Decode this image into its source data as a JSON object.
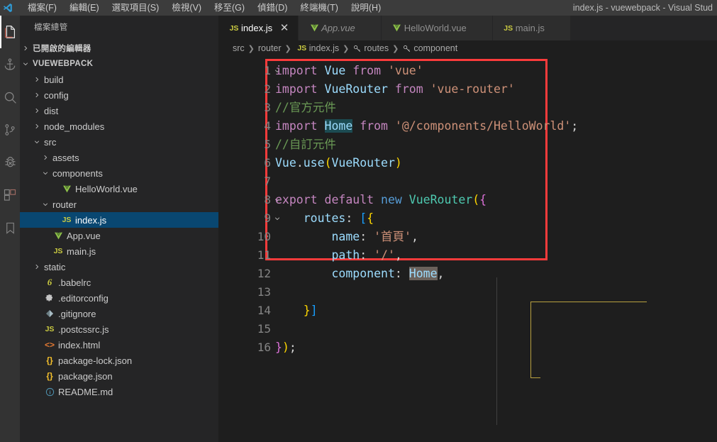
{
  "window": {
    "title": "index.js - vuewebpack - Visual Stud"
  },
  "menu": {
    "items": [
      {
        "label": "檔案(F)",
        "name": "menu-file"
      },
      {
        "label": "編輯(E)",
        "name": "menu-edit"
      },
      {
        "label": "選取項目(S)",
        "name": "menu-selection"
      },
      {
        "label": "檢視(V)",
        "name": "menu-view"
      },
      {
        "label": "移至(G)",
        "name": "menu-go"
      },
      {
        "label": "偵錯(D)",
        "name": "menu-debug"
      },
      {
        "label": "終端機(T)",
        "name": "menu-terminal"
      },
      {
        "label": "說明(H)",
        "name": "menu-help"
      }
    ]
  },
  "activitybar": {
    "items": [
      {
        "icon": "explorer-files-icon",
        "active": true
      },
      {
        "icon": "anchor-remote-icon",
        "active": false
      },
      {
        "icon": "search-icon",
        "active": false
      },
      {
        "icon": "source-control-icon",
        "active": false
      },
      {
        "icon": "debug-bug-icon",
        "active": false
      },
      {
        "icon": "extensions-icon",
        "active": false
      },
      {
        "icon": "bookmark-icon",
        "active": false
      }
    ]
  },
  "sidebar": {
    "title": "檔案總管",
    "sections": [
      {
        "label": "已開啟的編輯器",
        "expanded": false
      },
      {
        "label": "VUEWEBPACK",
        "expanded": true
      }
    ],
    "tree": [
      {
        "label": "build",
        "kind": "folder",
        "indent": 1,
        "expanded": false
      },
      {
        "label": "config",
        "kind": "folder",
        "indent": 1,
        "expanded": false
      },
      {
        "label": "dist",
        "kind": "folder",
        "indent": 1,
        "expanded": false
      },
      {
        "label": "node_modules",
        "kind": "folder",
        "indent": 1,
        "expanded": false
      },
      {
        "label": "src",
        "kind": "folder",
        "indent": 1,
        "expanded": true
      },
      {
        "label": "assets",
        "kind": "folder",
        "indent": 2,
        "expanded": false
      },
      {
        "label": "components",
        "kind": "folder",
        "indent": 2,
        "expanded": true
      },
      {
        "label": "HelloWorld.vue",
        "kind": "vue",
        "indent": 3
      },
      {
        "label": "router",
        "kind": "folder",
        "indent": 2,
        "expanded": true
      },
      {
        "label": "index.js",
        "kind": "js",
        "indent": 3,
        "selected": true
      },
      {
        "label": "App.vue",
        "kind": "vue",
        "indent": 2
      },
      {
        "label": "main.js",
        "kind": "js",
        "indent": 2
      },
      {
        "label": "static",
        "kind": "folder",
        "indent": 1,
        "expanded": false
      },
      {
        "label": ".babelrc",
        "kind": "babel",
        "indent": 1
      },
      {
        "label": ".editorconfig",
        "kind": "gear",
        "indent": 1
      },
      {
        "label": ".gitignore",
        "kind": "git",
        "indent": 1
      },
      {
        "label": ".postcssrc.js",
        "kind": "js",
        "indent": 1
      },
      {
        "label": "index.html",
        "kind": "html",
        "indent": 1
      },
      {
        "label": "package-lock.json",
        "kind": "json",
        "indent": 1
      },
      {
        "label": "package.json",
        "kind": "json",
        "indent": 1
      },
      {
        "label": "README.md",
        "kind": "info",
        "indent": 1
      }
    ]
  },
  "tabs": [
    {
      "label": "index.js",
      "kind": "js",
      "active": true,
      "preview": false,
      "close": "✕"
    },
    {
      "label": "App.vue",
      "kind": "vue",
      "active": false,
      "preview": true,
      "close": "✕"
    },
    {
      "label": "HelloWorld.vue",
      "kind": "vue",
      "active": false,
      "preview": false,
      "close": "✕"
    },
    {
      "label": "main.js",
      "kind": "js",
      "active": false,
      "preview": false,
      "close": "✕"
    }
  ],
  "breadcrumb": {
    "separator": "❯",
    "items": [
      {
        "label": "src",
        "icon": ""
      },
      {
        "label": "router",
        "icon": ""
      },
      {
        "label": "index.js",
        "icon": "js-file-icon"
      },
      {
        "label": "routes",
        "icon": "symbol-property-icon"
      },
      {
        "label": "component",
        "icon": "symbol-property-icon"
      }
    ]
  },
  "code": {
    "language": "javascript",
    "lines": [
      {
        "n": "1",
        "fold": "v",
        "tokens": [
          {
            "t": "import",
            "c": "t-kw"
          },
          {
            "t": " ",
            "c": "t-plain"
          },
          {
            "t": "Vue",
            "c": "t-id"
          },
          {
            "t": " ",
            "c": "t-plain"
          },
          {
            "t": "from",
            "c": "t-kw"
          },
          {
            "t": " ",
            "c": "t-plain"
          },
          {
            "t": "'vue'",
            "c": "t-str"
          }
        ]
      },
      {
        "n": "2",
        "fold": "",
        "tokens": [
          {
            "t": "import",
            "c": "t-kw"
          },
          {
            "t": " ",
            "c": "t-plain"
          },
          {
            "t": "VueRouter",
            "c": "t-id"
          },
          {
            "t": " ",
            "c": "t-plain"
          },
          {
            "t": "from",
            "c": "t-kw"
          },
          {
            "t": " ",
            "c": "t-plain"
          },
          {
            "t": "'vue-router'",
            "c": "t-str"
          }
        ]
      },
      {
        "n": "3",
        "fold": "",
        "tokens": [
          {
            "t": "//官方元件",
            "c": "t-cmt"
          }
        ]
      },
      {
        "n": "4",
        "fold": "",
        "tokens": [
          {
            "t": "import",
            "c": "t-kw"
          },
          {
            "t": " ",
            "c": "t-plain"
          },
          {
            "t": "Home",
            "c": "t-id hl-occ"
          },
          {
            "t": " ",
            "c": "t-plain"
          },
          {
            "t": "from",
            "c": "t-kw"
          },
          {
            "t": " ",
            "c": "t-plain"
          },
          {
            "t": "'@/components/HelloWorld'",
            "c": "t-str"
          },
          {
            "t": ";",
            "c": "t-plain"
          }
        ]
      },
      {
        "n": "5",
        "fold": "",
        "tokens": [
          {
            "t": "//自訂元件",
            "c": "t-cmt"
          }
        ]
      },
      {
        "n": "6",
        "fold": "",
        "tokens": [
          {
            "t": "Vue",
            "c": "t-id"
          },
          {
            "t": ".",
            "c": "t-plain"
          },
          {
            "t": "use",
            "c": "t-id"
          },
          {
            "t": "(",
            "c": "t-b1"
          },
          {
            "t": "VueRouter",
            "c": "t-id"
          },
          {
            "t": ")",
            "c": "t-b1"
          }
        ]
      },
      {
        "n": "7",
        "fold": "",
        "tokens": []
      },
      {
        "n": "8",
        "fold": "v",
        "tokens": [
          {
            "t": "export",
            "c": "t-kw"
          },
          {
            "t": " ",
            "c": "t-plain"
          },
          {
            "t": "default",
            "c": "t-kw"
          },
          {
            "t": " ",
            "c": "t-plain"
          },
          {
            "t": "new",
            "c": "t-kw2"
          },
          {
            "t": " ",
            "c": "t-plain"
          },
          {
            "t": "VueRouter",
            "c": "t-type"
          },
          {
            "t": "(",
            "c": "t-b1"
          },
          {
            "t": "{",
            "c": "t-b2"
          }
        ]
      },
      {
        "n": "9",
        "fold": "v",
        "tokens": [
          {
            "t": "    ",
            "c": "t-plain"
          },
          {
            "t": "routes",
            "c": "t-prop"
          },
          {
            "t": ": ",
            "c": "t-plain"
          },
          {
            "t": "[",
            "c": "t-b3"
          },
          {
            "t": "{",
            "c": "t-b1"
          }
        ]
      },
      {
        "n": "10",
        "fold": "",
        "tokens": [
          {
            "t": "        ",
            "c": "t-plain"
          },
          {
            "t": "name",
            "c": "t-prop"
          },
          {
            "t": ": ",
            "c": "t-plain"
          },
          {
            "t": "'首頁'",
            "c": "t-str"
          },
          {
            "t": ",",
            "c": "t-plain"
          }
        ]
      },
      {
        "n": "11",
        "fold": "",
        "tokens": [
          {
            "t": "        ",
            "c": "t-plain"
          },
          {
            "t": "path",
            "c": "t-prop"
          },
          {
            "t": ": ",
            "c": "t-plain"
          },
          {
            "t": "'/'",
            "c": "t-str"
          },
          {
            "t": ",",
            "c": "t-plain"
          }
        ]
      },
      {
        "n": "12",
        "fold": "",
        "tokens": [
          {
            "t": "        ",
            "c": "t-plain"
          },
          {
            "t": "component",
            "c": "t-prop"
          },
          {
            "t": ": ",
            "c": "t-plain"
          },
          {
            "t": "Home",
            "c": "t-id hl-sel"
          },
          {
            "t": ",",
            "c": "t-plain"
          }
        ]
      },
      {
        "n": "13",
        "fold": "",
        "tokens": []
      },
      {
        "n": "14",
        "fold": "",
        "tokens": [
          {
            "t": "    ",
            "c": "t-plain"
          },
          {
            "t": "}",
            "c": "t-b1"
          },
          {
            "t": "]",
            "c": "t-b3"
          }
        ]
      },
      {
        "n": "15",
        "fold": "",
        "tokens": []
      },
      {
        "n": "16",
        "fold": "",
        "tokens": [
          {
            "t": "}",
            "c": "t-b2"
          },
          {
            "t": ")",
            "c": "t-b1"
          },
          {
            "t": ";",
            "c": "t-plain"
          }
        ]
      }
    ]
  },
  "annotation": {
    "shape": "rectangle",
    "color": "#fb3b3b",
    "covers_lines": "8-16"
  },
  "colors": {
    "titlebar_bg": "#3c3c3c",
    "activitybar_bg": "#333333",
    "sidebar_bg": "#252526",
    "editor_bg": "#1e1e1e",
    "selection_blue": "#094771",
    "annotation_red": "#fb3b3b",
    "occurrence_highlight": "#1c4b52"
  }
}
